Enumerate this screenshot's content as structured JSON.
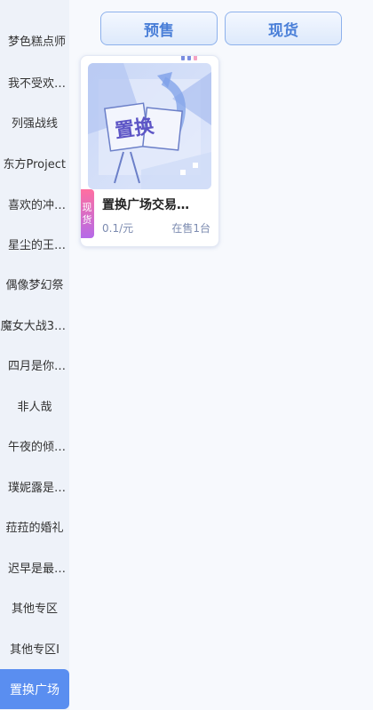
{
  "sidebar": {
    "items": [
      {
        "label": "梦色糕点师"
      },
      {
        "label": "我不受欢…"
      },
      {
        "label": "列强战线"
      },
      {
        "label": "东方Project"
      },
      {
        "label": "喜欢的冲…"
      },
      {
        "label": "星尘的王…"
      },
      {
        "label": "偶像梦幻祭"
      },
      {
        "label": "魔女大战3…"
      },
      {
        "label": "四月是你…"
      },
      {
        "label": "非人哉"
      },
      {
        "label": "午夜的倾…"
      },
      {
        "label": "璞妮露是…"
      },
      {
        "label": "菈菈的婚礼"
      },
      {
        "label": "迟早是最…"
      },
      {
        "label": "其他专区"
      },
      {
        "label": "其他专区I"
      },
      {
        "label": "置换广场"
      }
    ],
    "active_index": 16
  },
  "tabs": {
    "presale": "预售",
    "instock": "现货"
  },
  "product": {
    "tag_line1": "现",
    "tag_line2": "货",
    "image_text": "置换",
    "title": "置换广场交易…",
    "price": "0.1/元",
    "stock": "在售1台"
  },
  "colors": {
    "accent": "#5a8ef0",
    "tab_text": "#4a7fd8",
    "tag_gradient_top": "#ff6fa0",
    "tag_gradient_bottom": "#b56ae8"
  }
}
